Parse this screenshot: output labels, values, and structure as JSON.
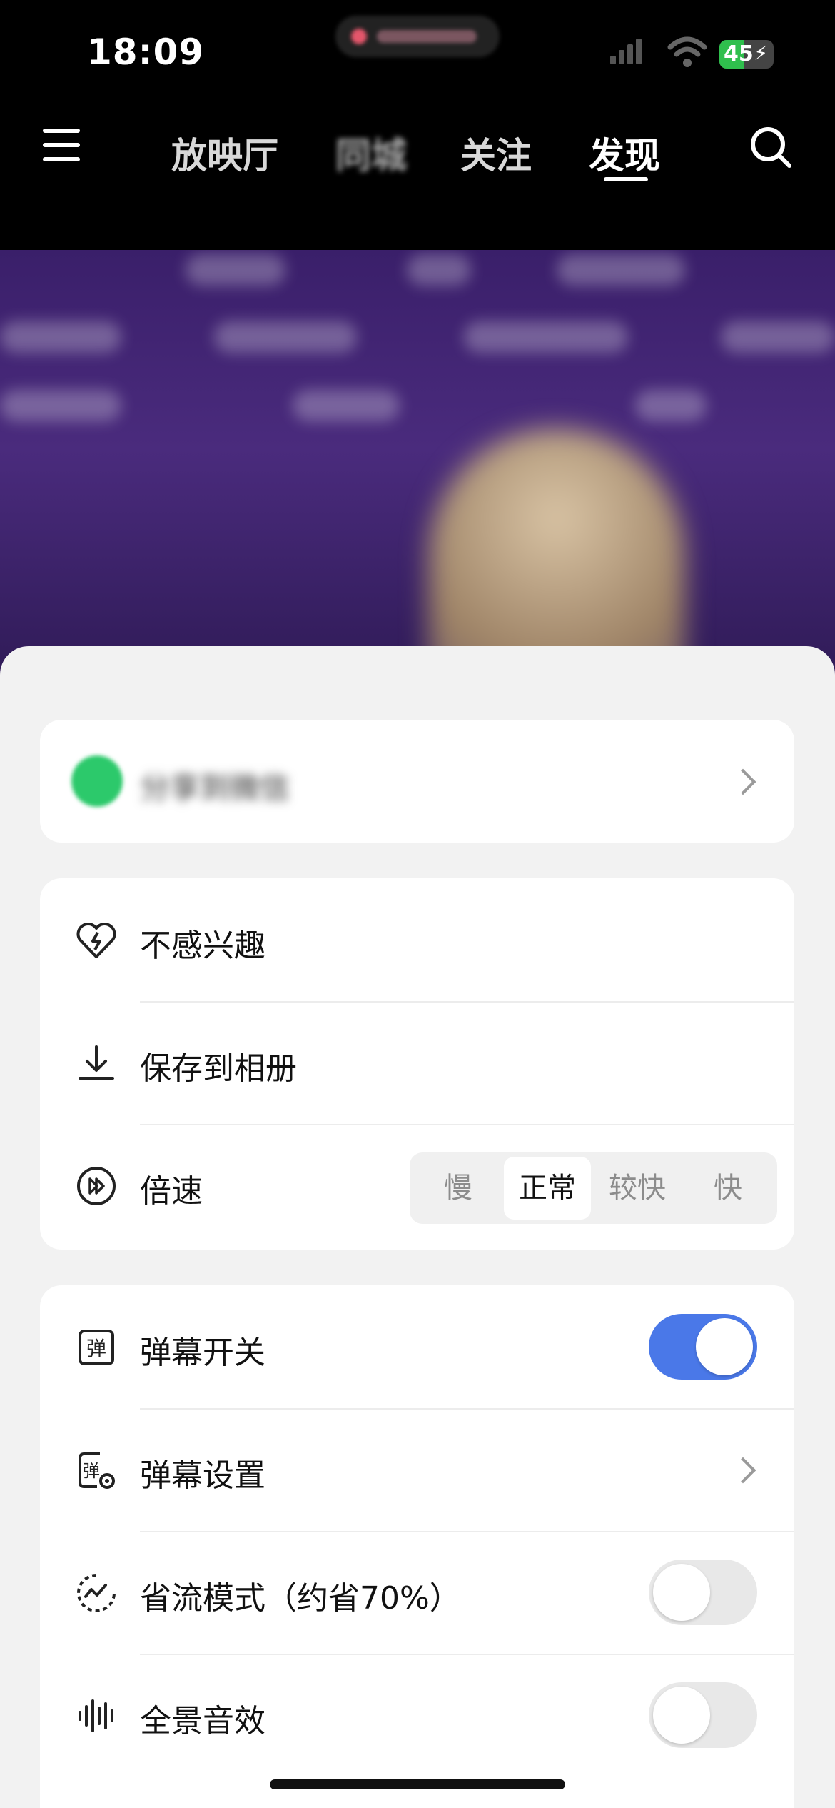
{
  "status_bar": {
    "time": "18:09",
    "battery": "45",
    "battery_level": 0.45
  },
  "nav": {
    "tabs": [
      {
        "label": "放映厅",
        "state": "normal"
      },
      {
        "label": "同城",
        "state": "blurred"
      },
      {
        "label": "关注",
        "state": "normal"
      },
      {
        "label": "发现",
        "state": "active"
      }
    ]
  },
  "sheet": {
    "share_label": "分享到微信",
    "menu1": [
      {
        "label": "不感兴趣",
        "icon": "broken-heart-icon"
      },
      {
        "label": "保存到相册",
        "icon": "download-icon"
      },
      {
        "label": "倍速",
        "icon": "fast-forward-icon"
      }
    ],
    "speed_options": [
      "慢",
      "正常",
      "较快",
      "快"
    ],
    "speed_selected": "正常",
    "menu2": [
      {
        "label": "弹幕开关",
        "icon": "danmaku-icon",
        "control": "toggle",
        "value": true
      },
      {
        "label": "弹幕设置",
        "icon": "danmaku-settings-icon",
        "control": "chevron"
      },
      {
        "label": "省流模式（约省70%）",
        "icon": "data-saver-icon",
        "control": "toggle",
        "value": false
      },
      {
        "label": "全景音效",
        "icon": "audio-wave-icon",
        "control": "toggle",
        "value": false
      }
    ]
  },
  "colors": {
    "accent": "#4a78e8",
    "wechat": "#2cc96b",
    "sheet_bg": "#f2f2f2"
  }
}
